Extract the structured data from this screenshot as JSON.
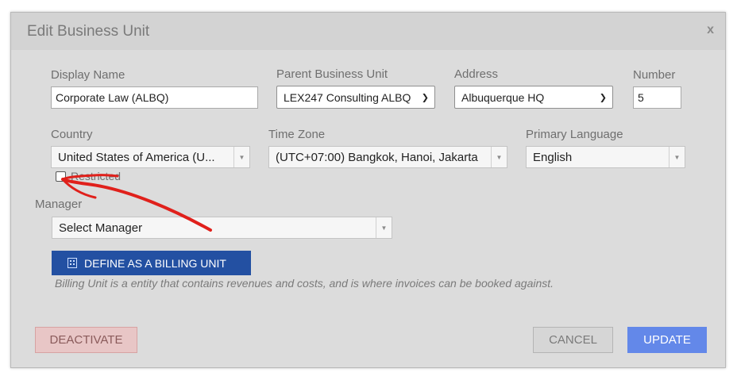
{
  "dialog": {
    "title": "Edit Business Unit",
    "close_label": "x"
  },
  "fields": {
    "display_name": {
      "label": "Display Name",
      "value": "Corporate Law (ALBQ)"
    },
    "parent_business_unit": {
      "label": "Parent Business Unit",
      "value": "LEX247 Consulting ALBQ"
    },
    "address": {
      "label": "Address",
      "value": "Albuquerque HQ"
    },
    "number": {
      "label": "Number",
      "value": "5"
    },
    "country": {
      "label": "Country",
      "value": "United States of America (U..."
    },
    "time_zone": {
      "label": "Time Zone",
      "value": "(UTC+07:00) Bangkok, Hanoi, Jakarta"
    },
    "primary_language": {
      "label": "Primary Language",
      "value": "English"
    },
    "restricted": {
      "label": "Restricted",
      "checked": false
    },
    "manager": {
      "label": "Manager",
      "value": "Select Manager"
    }
  },
  "billing": {
    "button_label": "DEFINE AS A BILLING UNIT",
    "icon": "building-icon",
    "note": "Billing Unit is a entity that contains revenues and costs, and is where invoices can be booked against."
  },
  "actions": {
    "deactivate": "DEACTIVATE",
    "cancel": "CANCEL",
    "update": "UPDATE"
  },
  "colors": {
    "billing_button": "#2350a2",
    "update_button": "#6388e9",
    "deactivate_button": "#e8c6c6",
    "annotation_arrow": "#e0201b"
  }
}
